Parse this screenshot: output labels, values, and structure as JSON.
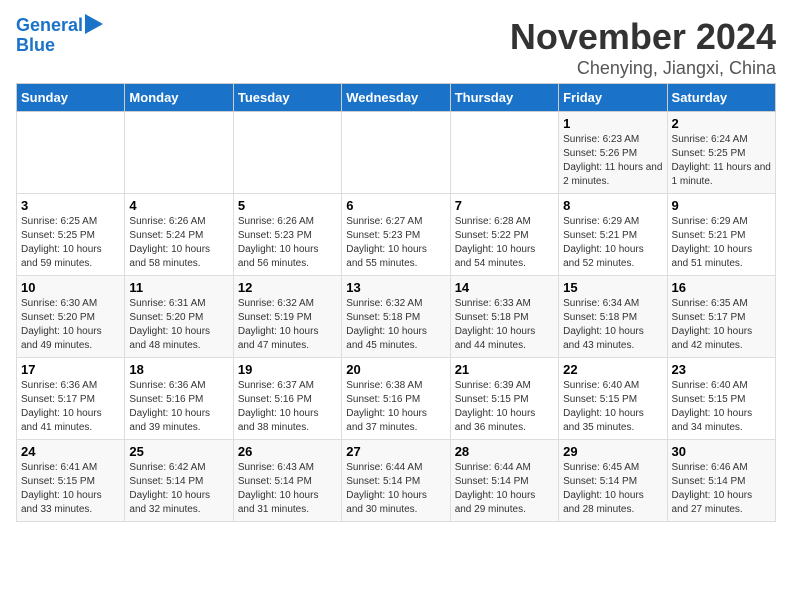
{
  "header": {
    "logo_line1": "General",
    "logo_line2": "Blue",
    "month": "November 2024",
    "location": "Chenying, Jiangxi, China"
  },
  "weekdays": [
    "Sunday",
    "Monday",
    "Tuesday",
    "Wednesday",
    "Thursday",
    "Friday",
    "Saturday"
  ],
  "weeks": [
    [
      {
        "day": "",
        "info": ""
      },
      {
        "day": "",
        "info": ""
      },
      {
        "day": "",
        "info": ""
      },
      {
        "day": "",
        "info": ""
      },
      {
        "day": "",
        "info": ""
      },
      {
        "day": "1",
        "info": "Sunrise: 6:23 AM\nSunset: 5:26 PM\nDaylight: 11 hours and 2 minutes."
      },
      {
        "day": "2",
        "info": "Sunrise: 6:24 AM\nSunset: 5:25 PM\nDaylight: 11 hours and 1 minute."
      }
    ],
    [
      {
        "day": "3",
        "info": "Sunrise: 6:25 AM\nSunset: 5:25 PM\nDaylight: 10 hours and 59 minutes."
      },
      {
        "day": "4",
        "info": "Sunrise: 6:26 AM\nSunset: 5:24 PM\nDaylight: 10 hours and 58 minutes."
      },
      {
        "day": "5",
        "info": "Sunrise: 6:26 AM\nSunset: 5:23 PM\nDaylight: 10 hours and 56 minutes."
      },
      {
        "day": "6",
        "info": "Sunrise: 6:27 AM\nSunset: 5:23 PM\nDaylight: 10 hours and 55 minutes."
      },
      {
        "day": "7",
        "info": "Sunrise: 6:28 AM\nSunset: 5:22 PM\nDaylight: 10 hours and 54 minutes."
      },
      {
        "day": "8",
        "info": "Sunrise: 6:29 AM\nSunset: 5:21 PM\nDaylight: 10 hours and 52 minutes."
      },
      {
        "day": "9",
        "info": "Sunrise: 6:29 AM\nSunset: 5:21 PM\nDaylight: 10 hours and 51 minutes."
      }
    ],
    [
      {
        "day": "10",
        "info": "Sunrise: 6:30 AM\nSunset: 5:20 PM\nDaylight: 10 hours and 49 minutes."
      },
      {
        "day": "11",
        "info": "Sunrise: 6:31 AM\nSunset: 5:20 PM\nDaylight: 10 hours and 48 minutes."
      },
      {
        "day": "12",
        "info": "Sunrise: 6:32 AM\nSunset: 5:19 PM\nDaylight: 10 hours and 47 minutes."
      },
      {
        "day": "13",
        "info": "Sunrise: 6:32 AM\nSunset: 5:18 PM\nDaylight: 10 hours and 45 minutes."
      },
      {
        "day": "14",
        "info": "Sunrise: 6:33 AM\nSunset: 5:18 PM\nDaylight: 10 hours and 44 minutes."
      },
      {
        "day": "15",
        "info": "Sunrise: 6:34 AM\nSunset: 5:18 PM\nDaylight: 10 hours and 43 minutes."
      },
      {
        "day": "16",
        "info": "Sunrise: 6:35 AM\nSunset: 5:17 PM\nDaylight: 10 hours and 42 minutes."
      }
    ],
    [
      {
        "day": "17",
        "info": "Sunrise: 6:36 AM\nSunset: 5:17 PM\nDaylight: 10 hours and 41 minutes."
      },
      {
        "day": "18",
        "info": "Sunrise: 6:36 AM\nSunset: 5:16 PM\nDaylight: 10 hours and 39 minutes."
      },
      {
        "day": "19",
        "info": "Sunrise: 6:37 AM\nSunset: 5:16 PM\nDaylight: 10 hours and 38 minutes."
      },
      {
        "day": "20",
        "info": "Sunrise: 6:38 AM\nSunset: 5:16 PM\nDaylight: 10 hours and 37 minutes."
      },
      {
        "day": "21",
        "info": "Sunrise: 6:39 AM\nSunset: 5:15 PM\nDaylight: 10 hours and 36 minutes."
      },
      {
        "day": "22",
        "info": "Sunrise: 6:40 AM\nSunset: 5:15 PM\nDaylight: 10 hours and 35 minutes."
      },
      {
        "day": "23",
        "info": "Sunrise: 6:40 AM\nSunset: 5:15 PM\nDaylight: 10 hours and 34 minutes."
      }
    ],
    [
      {
        "day": "24",
        "info": "Sunrise: 6:41 AM\nSunset: 5:15 PM\nDaylight: 10 hours and 33 minutes."
      },
      {
        "day": "25",
        "info": "Sunrise: 6:42 AM\nSunset: 5:14 PM\nDaylight: 10 hours and 32 minutes."
      },
      {
        "day": "26",
        "info": "Sunrise: 6:43 AM\nSunset: 5:14 PM\nDaylight: 10 hours and 31 minutes."
      },
      {
        "day": "27",
        "info": "Sunrise: 6:44 AM\nSunset: 5:14 PM\nDaylight: 10 hours and 30 minutes."
      },
      {
        "day": "28",
        "info": "Sunrise: 6:44 AM\nSunset: 5:14 PM\nDaylight: 10 hours and 29 minutes."
      },
      {
        "day": "29",
        "info": "Sunrise: 6:45 AM\nSunset: 5:14 PM\nDaylight: 10 hours and 28 minutes."
      },
      {
        "day": "30",
        "info": "Sunrise: 6:46 AM\nSunset: 5:14 PM\nDaylight: 10 hours and 27 minutes."
      }
    ]
  ]
}
